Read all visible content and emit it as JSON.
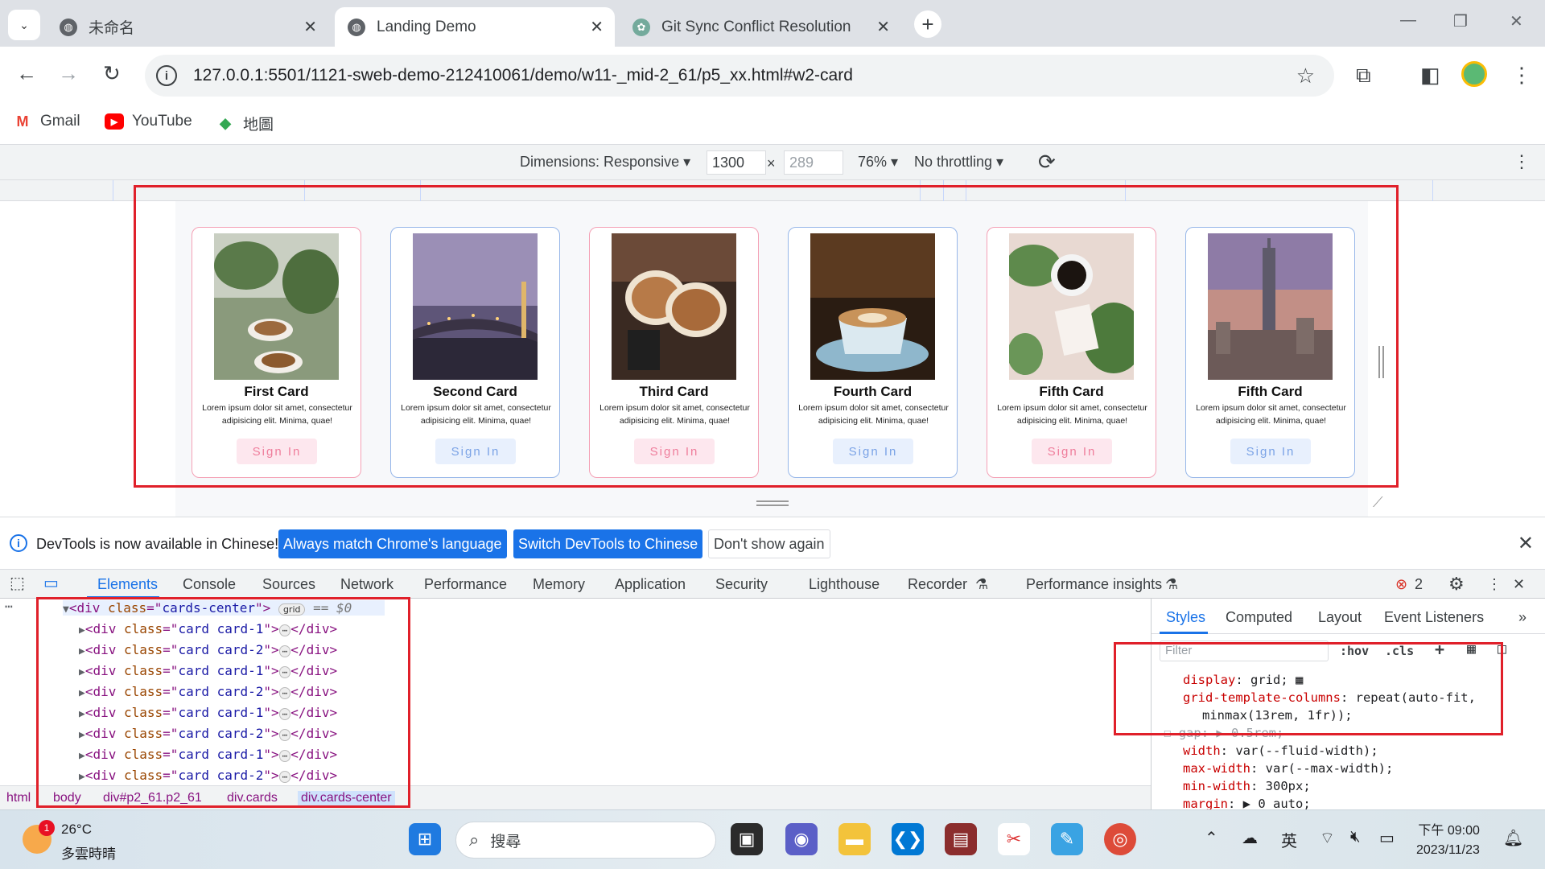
{
  "browser": {
    "tabs": [
      {
        "label": "未命名"
      },
      {
        "label": "Landing Demo"
      },
      {
        "label": "Git Sync Conflict Resolution"
      }
    ],
    "url": "127.0.0.1:5501/1121-sweb-demo-212410061/demo/w11-_mid-2_61/p5_xx.html#w2-card",
    "bookmarks": [
      {
        "label": "Gmail"
      },
      {
        "label": "YouTube"
      },
      {
        "label": "地圖"
      }
    ]
  },
  "device_toolbar": {
    "dimensions_label": "Dimensions: Responsive ▾",
    "width": "1300",
    "times": "×",
    "height": "289",
    "zoom": "76% ▾",
    "throttling": "No throttling ▾"
  },
  "cards": [
    {
      "title": "First Card",
      "body": "Lorem ipsum dolor sit amet, consectetur adipisicing elit. Minima, quae!",
      "button": "Sign In",
      "variant": "card-1"
    },
    {
      "title": "Second Card",
      "body": "Lorem ipsum dolor sit amet, consectetur adipisicing elit. Minima, quae!",
      "button": "Sign In",
      "variant": "card-2"
    },
    {
      "title": "Third Card",
      "body": "Lorem ipsum dolor sit amet, consectetur adipisicing elit. Minima, quae!",
      "button": "Sign In",
      "variant": "card-1"
    },
    {
      "title": "Fourth Card",
      "body": "Lorem ipsum dolor sit amet, consectetur adipisicing elit. Minima, quae!",
      "button": "Sign In",
      "variant": "card-2"
    },
    {
      "title": "Fifth Card",
      "body": "Lorem ipsum dolor sit amet, consectetur adipisicing elit. Minima, quae!",
      "button": "Sign In",
      "variant": "card-1"
    },
    {
      "title": "Fifth Card",
      "body": "Lorem ipsum dolor sit amet, consectetur adipisicing elit. Minima, quae!",
      "button": "Sign In",
      "variant": "card-2"
    }
  ],
  "devtools": {
    "lang_banner": {
      "message": "DevTools is now available in Chinese!",
      "btn_match": "Always match Chrome's language",
      "btn_switch": "Switch DevTools to Chinese",
      "btn_dismiss": "Don't show again"
    },
    "tabs": [
      "Elements",
      "Console",
      "Sources",
      "Network",
      "Performance",
      "Memory",
      "Application",
      "Security",
      "Lighthouse",
      "Recorder",
      "Performance insights"
    ],
    "error_count": "2",
    "dom": {
      "parent": {
        "tag": "div",
        "class": "cards-center",
        "badge": "grid",
        "suffix": "== $0"
      },
      "children": [
        "card card-1",
        "card card-2",
        "card card-1",
        "card card-2",
        "card card-1",
        "card card-2",
        "card card-1",
        "card card-2"
      ]
    },
    "breadcrumbs": [
      "html",
      "body",
      "div#p2_61.p2_61",
      "div.cards",
      "div.cards-center"
    ],
    "styles_tabs": [
      "Styles",
      "Computed",
      "Layout",
      "Event Listeners",
      "»"
    ],
    "filter_placeholder": "Filter",
    "hov": ":hov",
    "cls": ".cls",
    "css_rules": [
      {
        "prop": "display",
        "value": "grid;"
      },
      {
        "prop": "grid-template-columns",
        "value": "repeat(auto-fit,"
      },
      {
        "prop": "",
        "value": "minmax(13rem, 1fr));"
      },
      {
        "prop": "gap",
        "value": "▶ 0.5rem;"
      },
      {
        "prop": "width",
        "value": "var(--fluid-width);"
      },
      {
        "prop": "max-width",
        "value": "var(--max-width);"
      },
      {
        "prop": "min-width",
        "value": "300px;"
      },
      {
        "prop": "margin",
        "value": "▶ 0 auto;"
      }
    ]
  },
  "taskbar": {
    "temperature": "26°C",
    "weather_desc": "多雲時晴",
    "weather_badge": "1",
    "search_placeholder": "搜尋",
    "ime": "英",
    "time": "下午 09:00",
    "date": "2023/11/23"
  },
  "colors": {
    "highlight": "#e0202a",
    "accent": "#1a73e8",
    "card1_border": "#f4a0b5",
    "card2_border": "#97b7e9"
  }
}
